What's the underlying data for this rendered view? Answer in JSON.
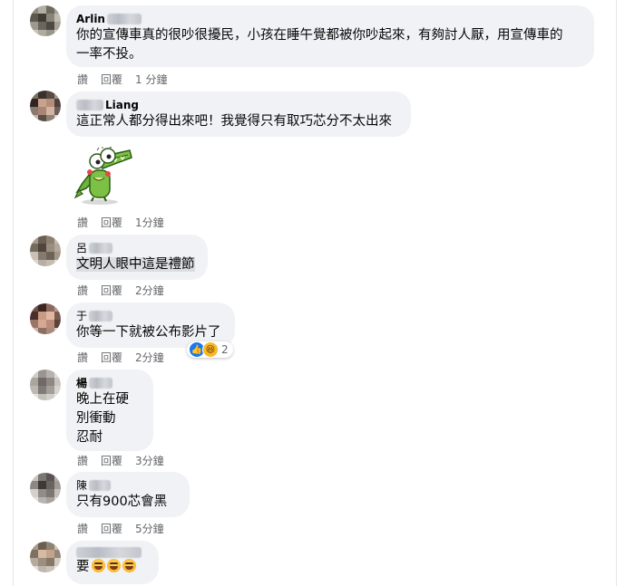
{
  "comments": [
    {
      "name": "Arlin",
      "text": "你的宣傳車真的很吵很擾民，小孩在睡午覺都被你吵起來，有夠討人厭，用宣傳車的一率不投。",
      "line1": "你的宣傳車真的很吵很擾民，小孩在睡午覺都被你吵起來，有夠討人厭，用宣傳車的",
      "line2": "一率不投。",
      "like": "讚",
      "reply": "回覆",
      "time": "1 分鐘"
    },
    {
      "name": "Liang",
      "text": "這正常人都分得出來吧！我覺得只有取巧芯分不太出來",
      "like": "讚",
      "reply": "回覆",
      "time": "1分鐘",
      "sticker": "crocodile-sticker"
    },
    {
      "name": "呂",
      "text": "文明人眼中這是禮節",
      "like": "讚",
      "reply": "回覆",
      "time": "2分鐘"
    },
    {
      "name": "于",
      "text": "你等一下就被公布影片了",
      "like": "讚",
      "reply": "回覆",
      "time": "2分鐘",
      "reaction_count": "2"
    },
    {
      "name": "楊",
      "line1": "晚上在硬",
      "line2": "別衝動",
      "line3": "忍耐",
      "like": "讚",
      "reply": "回覆",
      "time": "3分鐘"
    },
    {
      "name": "陳",
      "text": "只有900芯會黑",
      "like": "讚",
      "reply": "回覆",
      "time": "5分鐘"
    },
    {
      "name": "",
      "text": "要",
      "emoji_count": 3
    }
  ],
  "colors": {
    "bubble": "#f0f2f5",
    "meta": "#65676b",
    "like_blue": "#1877f2",
    "haha": "#f7b928"
  }
}
